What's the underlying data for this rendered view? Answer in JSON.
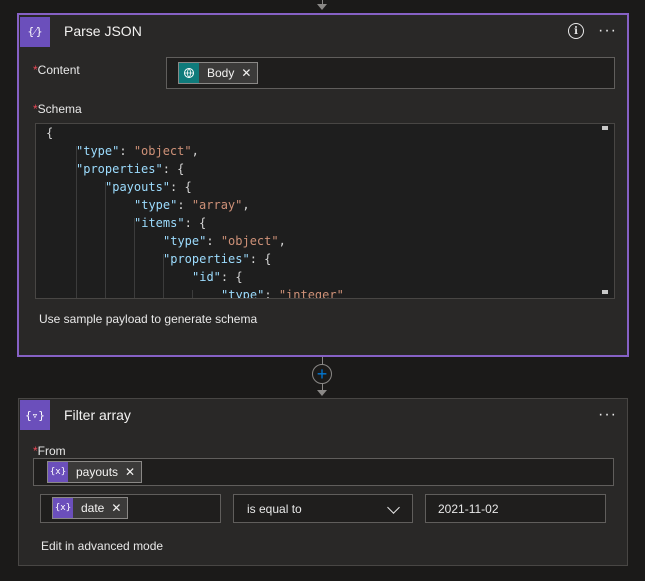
{
  "parse_json": {
    "title": "Parse JSON",
    "icon_text": "{⁄}",
    "content_label": "Content",
    "content_token": {
      "label": "Body",
      "icon": "globe-icon"
    },
    "schema_label": "Schema",
    "schema_lines": [
      {
        "key": "{",
        "val": ""
      },
      {
        "key": "\"type\"",
        "val": "\"object\""
      },
      {
        "key": "\"properties\"",
        "val": "{"
      },
      {
        "key": "\"payouts\"",
        "val": "{"
      },
      {
        "key": "\"type\"",
        "val": "\"array\""
      },
      {
        "key": "\"items\"",
        "val": "{"
      },
      {
        "key": "\"type\"",
        "val": "\"object\""
      },
      {
        "key": "\"properties\"",
        "val": "{"
      },
      {
        "key": "\"id\"",
        "val": "{"
      },
      {
        "key": "\"type\"",
        "val": "\"integer\""
      }
    ],
    "sample_payload_link": "Use sample payload to generate schema",
    "required_mark": "*"
  },
  "filter_array": {
    "title": "Filter array",
    "icon_text": "{▿}",
    "from_label": "From",
    "from_token": {
      "label": "payouts"
    },
    "condition": {
      "left_token": {
        "label": "date"
      },
      "operator": "is equal to",
      "right_value": "2021-11-02"
    },
    "advanced_link": "Edit in advanced mode",
    "required_mark": "*"
  },
  "colors": {
    "accent": "#8661c5",
    "token_parse": "#0f7b7b",
    "token_var": "#6b4fbb",
    "add_button": "#0078d4"
  }
}
